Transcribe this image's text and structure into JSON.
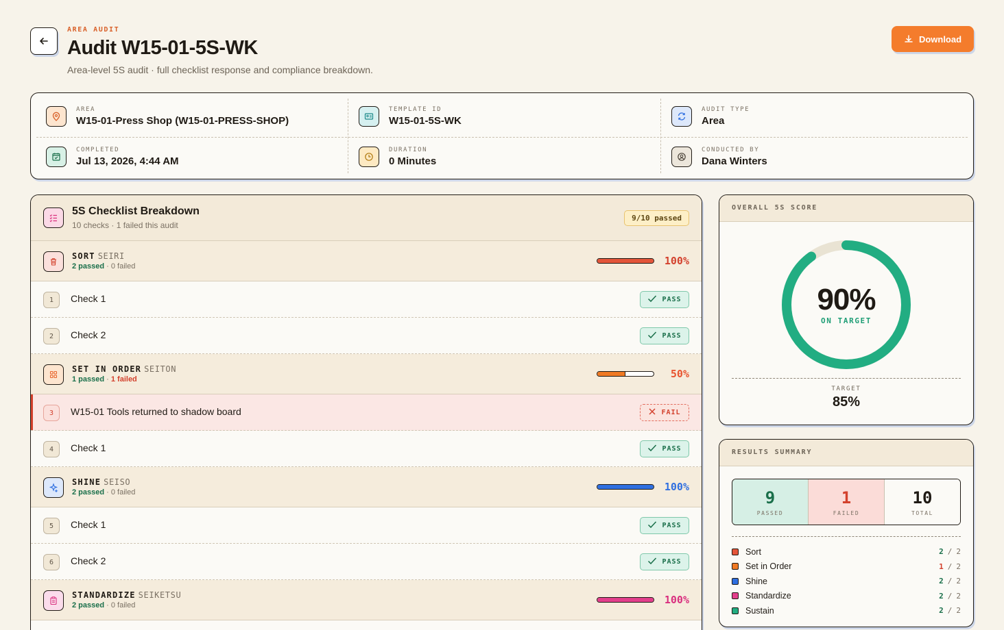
{
  "header": {
    "eyebrow": "AREA AUDIT",
    "title": "Audit W15-01-5S-WK",
    "subtitle": "Area-level 5S audit · full checklist response and compliance breakdown.",
    "download_label": "Download"
  },
  "info": {
    "area": {
      "label": "AREA",
      "value": "W15-01-Press Shop (W15-01-PRESS-SHOP)",
      "icon": "location-pin-icon"
    },
    "template": {
      "label": "TEMPLATE ID",
      "value": "W15-01-5S-WK",
      "icon": "id-card-icon"
    },
    "audit_type": {
      "label": "AUDIT TYPE",
      "value": "Area",
      "icon": "refresh-icon"
    },
    "completed": {
      "label": "COMPLETED",
      "value": "Jul 13, 2026, 4:44 AM",
      "icon": "calendar-check-icon"
    },
    "duration": {
      "label": "DURATION",
      "value": "0 Minutes",
      "icon": "clock-icon"
    },
    "conducted_by": {
      "label": "CONDUCTED BY",
      "value": "Dana Winters",
      "icon": "user-circle-icon"
    }
  },
  "checklist": {
    "title": "5S Checklist Breakdown",
    "subtitle": "10 checks · 1 failed this audit",
    "badge": "9/10 passed",
    "categories": [
      {
        "name": "SORT",
        "jp": "SEIRI",
        "passed": "2 passed",
        "sep": " · ",
        "failed": "0 failed",
        "percent": "100%",
        "fill": 1.0,
        "color": "#e4553a",
        "pct_color": "#d3412d",
        "icon_bg": "#fbe0dc",
        "icon": "trash-icon",
        "checks": [
          {
            "num": "1",
            "label": "Check 1",
            "status": "PASS"
          },
          {
            "num": "2",
            "label": "Check 2",
            "status": "PASS"
          }
        ]
      },
      {
        "name": "SET IN ORDER",
        "jp": "SEITON",
        "passed": "1 passed",
        "sep": " · ",
        "failed": "1 failed",
        "percent": "50%",
        "fill": 0.5,
        "color": "#f07a24",
        "pct_color": "#e8542f",
        "icon_bg": "#fde5cf",
        "icon": "grid-icon",
        "checks": [
          {
            "num": "3",
            "label": "W15-01 Tools returned to shadow board",
            "status": "FAIL"
          },
          {
            "num": "4",
            "label": "Check 1",
            "status": "PASS"
          }
        ]
      },
      {
        "name": "SHINE",
        "jp": "SEISO",
        "passed": "2 passed",
        "sep": " · ",
        "failed": "0 failed",
        "percent": "100%",
        "fill": 1.0,
        "color": "#2f6fe0",
        "pct_color": "#2f6fe0",
        "icon_bg": "#dde8fb",
        "icon": "sparkle-icon",
        "checks": [
          {
            "num": "5",
            "label": "Check 1",
            "status": "PASS"
          },
          {
            "num": "6",
            "label": "Check 2",
            "status": "PASS"
          }
        ]
      },
      {
        "name": "STANDARDIZE",
        "jp": "SEIKETSU",
        "passed": "2 passed",
        "sep": " · ",
        "failed": "0 failed",
        "percent": "100%",
        "fill": 1.0,
        "color": "#e33f8c",
        "pct_color": "#d92e7e",
        "icon_bg": "#fbdceb",
        "icon": "clipboard-icon",
        "checks": []
      }
    ]
  },
  "score": {
    "heading": "OVERALL 5S SCORE",
    "percent": "90%",
    "value": 0.9,
    "status": "ON TARGET",
    "target_label": "TARGET",
    "target_value": "85%",
    "ring_color": "#22ad82",
    "track_color": "#e9e3d3"
  },
  "results": {
    "heading": "RESULTS SUMMARY",
    "passed": {
      "n": "9",
      "label": "PASSED"
    },
    "failed": {
      "n": "1",
      "label": "FAILED"
    },
    "total": {
      "n": "10",
      "label": "TOTAL"
    },
    "legend": [
      {
        "name": "Sort",
        "pass": "2",
        "total": "2",
        "color": "#e4553a",
        "bad": false
      },
      {
        "name": "Set in Order",
        "pass": "1",
        "total": "2",
        "color": "#f07a24",
        "bad": true
      },
      {
        "name": "Shine",
        "pass": "2",
        "total": "2",
        "color": "#2f6fe0",
        "bad": false
      },
      {
        "name": "Standardize",
        "pass": "2",
        "total": "2",
        "color": "#e33f8c",
        "bad": false
      },
      {
        "name": "Sustain",
        "pass": "2",
        "total": "2",
        "color": "#22ad82",
        "bad": false
      }
    ]
  }
}
